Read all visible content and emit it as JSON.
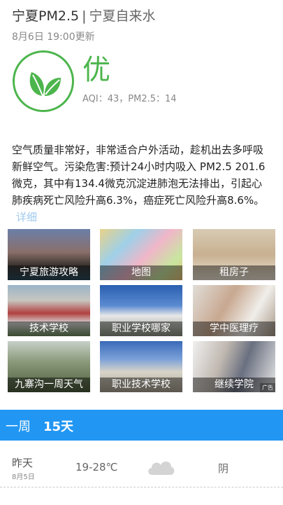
{
  "header": {
    "title": "宁夏PM2.5",
    "separator": "|",
    "subtitle": "宁夏自来水"
  },
  "updated": "8月6日 19:00更新",
  "aqi": {
    "level": "优",
    "meta": "AQI：43，PM2.5：14",
    "color": "#4cb54c"
  },
  "description": "空气质量非常好，非常适合户外活动，趁机出去多呼吸新鲜空气。污染危害:预计24小时内吸入 PM2.5 201.6微克，其中有134.4微克沉淀进肺泡无法排出，引起心肺疾病死亡风险升高6.3%，癌症死亡风险升高8.6%。",
  "more_link": "详细",
  "tiles": [
    {
      "label": "宁夏旅游攻略"
    },
    {
      "label": "地图"
    },
    {
      "label": "租房子"
    },
    {
      "label": "技术学校"
    },
    {
      "label": "职业学校哪家"
    },
    {
      "label": "学中医理疗"
    },
    {
      "label": "九寨沟一周天气"
    },
    {
      "label": "职业技术学校"
    },
    {
      "label": "继续学院"
    }
  ],
  "ad_badge": "广告",
  "forecast_tabs": {
    "week": "一周",
    "days15": "15天"
  },
  "forecast": [
    {
      "day": "昨天",
      "date": "8月5日",
      "temp": "19-28℃",
      "condition": "阴"
    }
  ]
}
